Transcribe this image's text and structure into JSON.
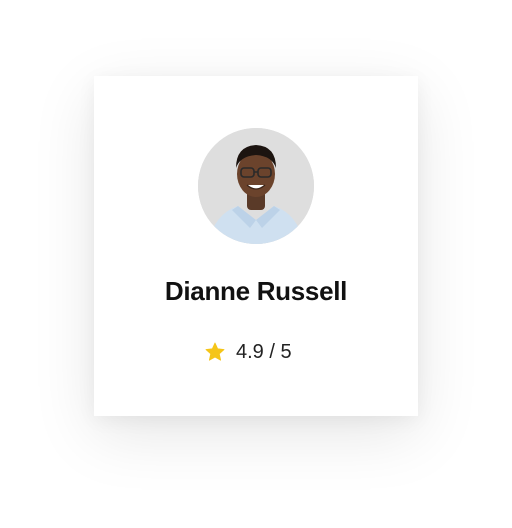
{
  "profile": {
    "name": "Dianne Russell",
    "rating_value": "4.9",
    "rating_separator": "/",
    "rating_max": "5",
    "rating_display": "4.9 / 5"
  },
  "icons": {
    "rating": "star-icon",
    "avatar": "avatar"
  },
  "colors": {
    "star": "#F5C518",
    "text": "#111111"
  }
}
